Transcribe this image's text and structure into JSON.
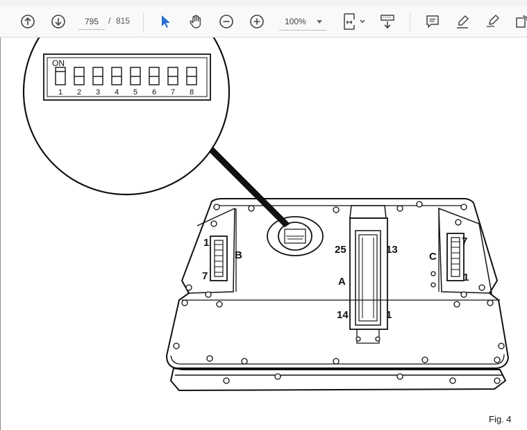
{
  "toolbar": {
    "current_page": "795",
    "page_separator": "/",
    "total_pages": "815",
    "zoom": "100%",
    "icons": [
      "arrow-up-icon",
      "arrow-down-icon",
      "pointer-icon",
      "hand-icon",
      "zoom-out-icon",
      "zoom-in-icon",
      "fit-page-icon",
      "scroll-mode-icon",
      "comment-icon",
      "highlight-icon",
      "sign-icon",
      "rotate-icon"
    ],
    "active_color": "#2a6fd6"
  },
  "figure": {
    "dip_switch": {
      "on_label": "ON",
      "switch_numbers": [
        "1",
        "2",
        "3",
        "4",
        "5",
        "6",
        "7",
        "8"
      ],
      "on_state": [
        true,
        false,
        false,
        false,
        false,
        false,
        false,
        false
      ]
    },
    "connector_a": {
      "label": "A",
      "pin_top_left": "25",
      "pin_top_right": "13",
      "pin_bottom_left": "14",
      "pin_bottom_right": "1"
    },
    "connector_b": {
      "label": "B",
      "pin_top": "1",
      "pin_bottom": "7"
    },
    "connector_c": {
      "label": "C",
      "pin_top": "7",
      "pin_bottom": "1"
    },
    "caption": "Fig. 4"
  }
}
